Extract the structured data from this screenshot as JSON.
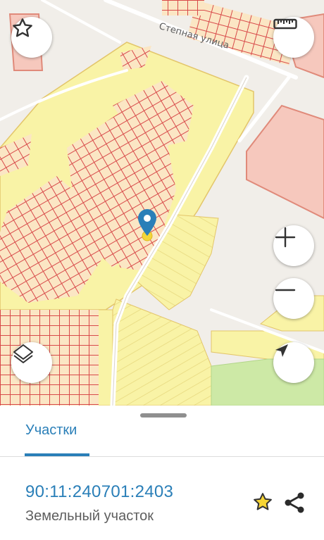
{
  "map": {
    "street_label": "Степная улица",
    "icons": {
      "favorite": "star-outline-icon",
      "ruler": "ruler-icon",
      "zoom_in": "plus-icon",
      "zoom_out": "minus-icon",
      "layers": "layers-icon",
      "locate": "navigation-arrow-icon",
      "marker": "location-pin-icon"
    },
    "colors": {
      "parcel_fill": "#f9f3a6",
      "parcel_border": "#e06a6a",
      "building_fill": "#f6c8bd",
      "park_fill": "#cde9a6",
      "road": "#ffffff",
      "pin": "#2a7fb8"
    }
  },
  "sheet": {
    "tab_label": "Участки",
    "parcel_number": "90:11:240701:2403",
    "parcel_type": "Земельный участок",
    "icons": {
      "favorite": "star-icon",
      "share": "share-icon"
    }
  }
}
